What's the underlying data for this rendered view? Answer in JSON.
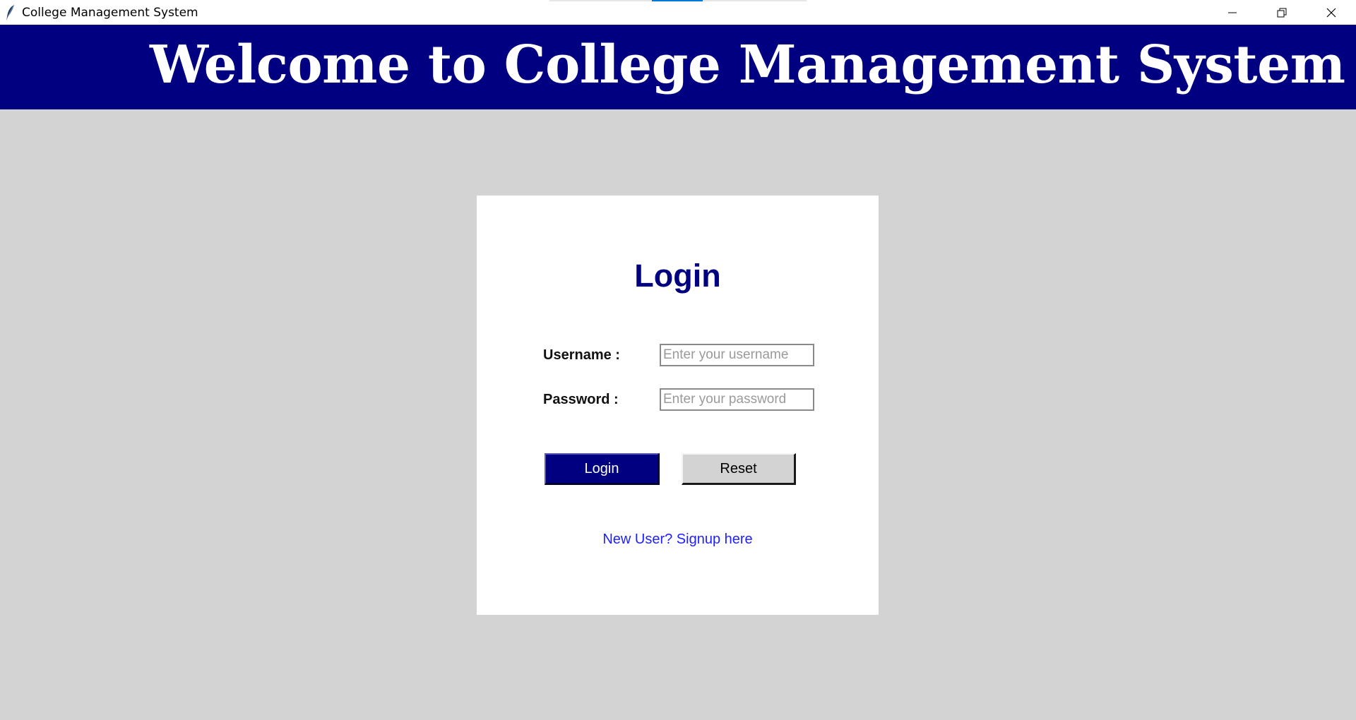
{
  "window": {
    "title": "College Management System",
    "controls": {
      "minimize_icon": "minimize-icon",
      "maximize_icon": "restore-icon",
      "close_icon": "close-icon"
    }
  },
  "banner": {
    "text": "Welcome to College Management System",
    "background": "#000080",
    "text_color": "#ffffff"
  },
  "login": {
    "heading": "Login",
    "username_label": "Username :",
    "username_value": "",
    "username_placeholder": "Enter your username",
    "password_label": "Password :",
    "password_value": "",
    "password_placeholder": "Enter your password",
    "login_button": "Login",
    "reset_button": "Reset",
    "signup_link": "New User? Signup here"
  },
  "colors": {
    "accent": "#000080",
    "page_background": "#d3d3d3",
    "card_background": "#ffffff",
    "link": "#1f1fff"
  }
}
